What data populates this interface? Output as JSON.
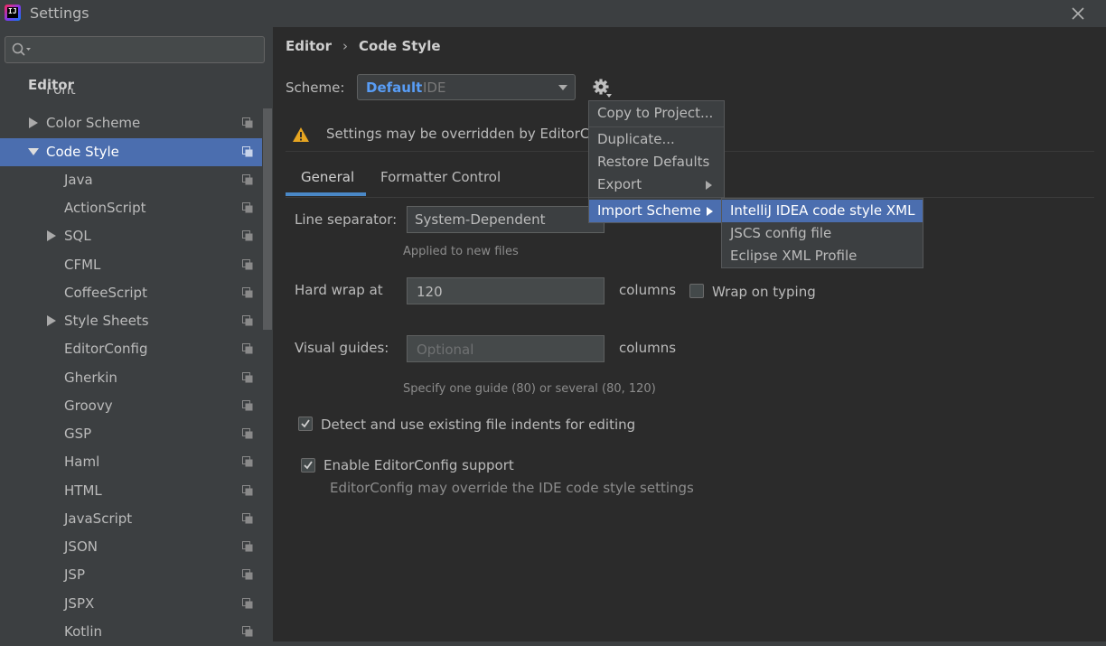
{
  "window": {
    "title": "Settings"
  },
  "sidebar": {
    "search_placeholder": "",
    "section_header": "Editor",
    "partial_item": "Font",
    "items": [
      {
        "label": "Color Scheme"
      },
      {
        "label": "Code Style"
      },
      {
        "label": "Java"
      },
      {
        "label": "ActionScript"
      },
      {
        "label": "SQL"
      },
      {
        "label": "CFML"
      },
      {
        "label": "CoffeeScript"
      },
      {
        "label": "Style Sheets"
      },
      {
        "label": "EditorConfig"
      },
      {
        "label": "Gherkin"
      },
      {
        "label": "Groovy"
      },
      {
        "label": "GSP"
      },
      {
        "label": "Haml"
      },
      {
        "label": "HTML"
      },
      {
        "label": "JavaScript"
      },
      {
        "label": "JSON"
      },
      {
        "label": "JSP"
      },
      {
        "label": "JSPX"
      },
      {
        "label": "Kotlin"
      }
    ]
  },
  "breadcrumb": {
    "parent": "Editor",
    "separator": "›",
    "current": "Code Style"
  },
  "scheme": {
    "label": "Scheme:",
    "name": "Default",
    "type": "IDE"
  },
  "warning": {
    "text": "Settings may be overridden by EditorConfig"
  },
  "tabs": [
    {
      "label": "General"
    },
    {
      "label": "Formatter Control"
    }
  ],
  "form": {
    "line_separator_label": "Line separator:",
    "line_separator_value": "System-Dependent",
    "line_separator_hint": "Applied to new files",
    "hard_wrap_label": "Hard wrap at",
    "hard_wrap_value": "120",
    "hard_wrap_unit": "columns",
    "wrap_on_typing_label": "Wrap on typing",
    "visual_guides_label": "Visual guides:",
    "visual_guides_placeholder": "Optional",
    "visual_guides_unit": "columns",
    "visual_guides_hint": "Specify one guide (80) or several (80, 120)",
    "detect_indents_label": "Detect and use existing file indents for editing",
    "editorconfig_label": "Enable EditorConfig support",
    "editorconfig_hint": "EditorConfig may override the IDE code style settings"
  },
  "gear_menu": {
    "items": [
      {
        "label": "Copy to Project..."
      },
      {
        "label": "Duplicate..."
      },
      {
        "label": "Restore Defaults"
      },
      {
        "label": "Export"
      },
      {
        "label": "Import Scheme"
      }
    ]
  },
  "import_menu": {
    "items": [
      {
        "label": "IntelliJ IDEA code style XML"
      },
      {
        "label": "JSCS config file"
      },
      {
        "label": "Eclipse XML Profile"
      }
    ]
  },
  "colors": {
    "accent": "#4b6eaf",
    "link": "#589df6",
    "warning": "#e6a521",
    "background": "#2b2b2b",
    "sidebar": "#3c3f41"
  }
}
